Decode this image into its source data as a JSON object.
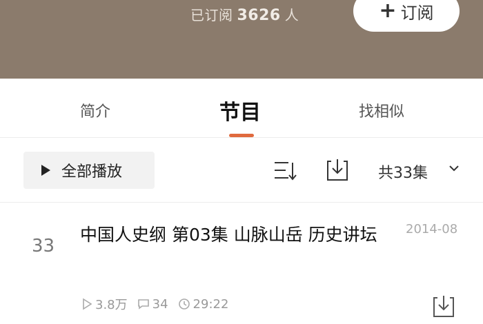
{
  "header": {
    "subs_prefix": "已订阅",
    "subs_count": "3626",
    "subs_suffix": "人",
    "subscribe_plus": "+",
    "subscribe_label": "订阅"
  },
  "tabs": [
    {
      "label": "简介"
    },
    {
      "label": "节目"
    },
    {
      "label": "找相似"
    }
  ],
  "toolbar": {
    "play_all_label": "全部播放",
    "episode_count": "共33集"
  },
  "episodes": [
    {
      "index": "33",
      "title": "中国人史纲 第03集 山脉山岳 历史讲坛",
      "date": "2014-08",
      "plays": "3.8万",
      "comments": "34",
      "duration": "29:22"
    }
  ],
  "colors": {
    "header_bg": "#8b7b6c",
    "accent": "#e06a3e"
  }
}
